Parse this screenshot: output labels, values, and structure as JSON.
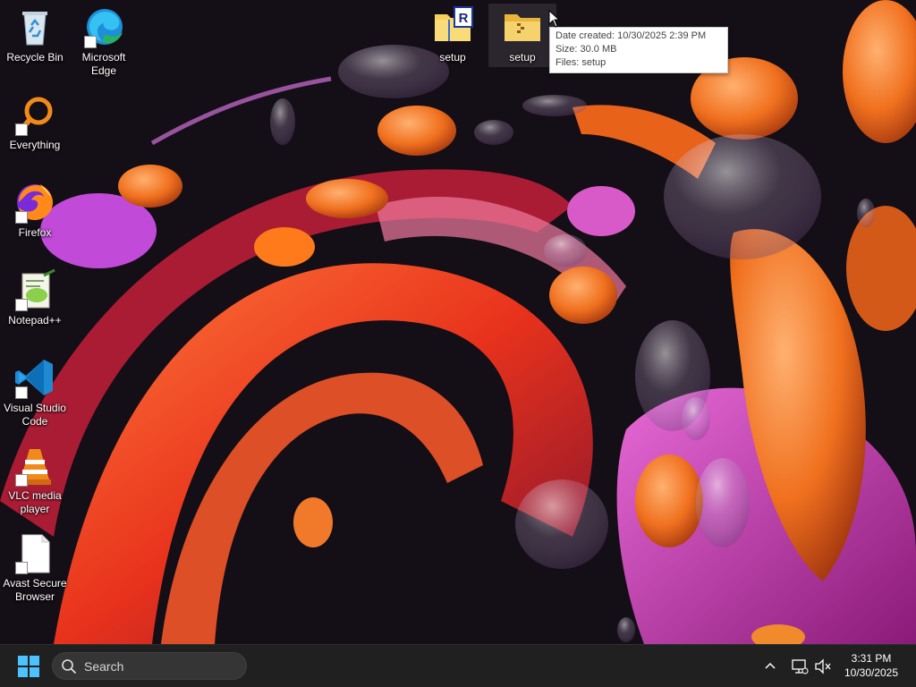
{
  "desktop": {
    "icons": [
      {
        "label": "Recycle Bin",
        "icon": "recycle-bin-icon"
      },
      {
        "label": "Microsoft Edge",
        "icon": "edge-icon"
      },
      {
        "label": "Everything",
        "icon": "everything-search-icon"
      },
      {
        "label": "Firefox",
        "icon": "firefox-icon"
      },
      {
        "label": "Notepad++",
        "icon": "notepadpp-icon"
      },
      {
        "label": "Visual Studio Code",
        "icon": "vscode-icon"
      },
      {
        "label": "VLC media player",
        "icon": "vlc-icon"
      },
      {
        "label": "Avast Secure Browser",
        "icon": "blank-file-icon"
      },
      {
        "label": "setup",
        "icon": "rar-archive-icon"
      },
      {
        "label": "setup",
        "icon": "zip-folder-icon"
      }
    ]
  },
  "tooltip": {
    "line1": "Date created: 10/30/2025 2:39 PM",
    "line2": "Size: 30.0 MB",
    "line3": "Files: setup"
  },
  "taskbar": {
    "search_placeholder": "Search",
    "time": "3:31 PM",
    "date": "10/30/2025"
  },
  "colors": {
    "taskbar_bg": "#202020",
    "accent": "#0078d4"
  }
}
